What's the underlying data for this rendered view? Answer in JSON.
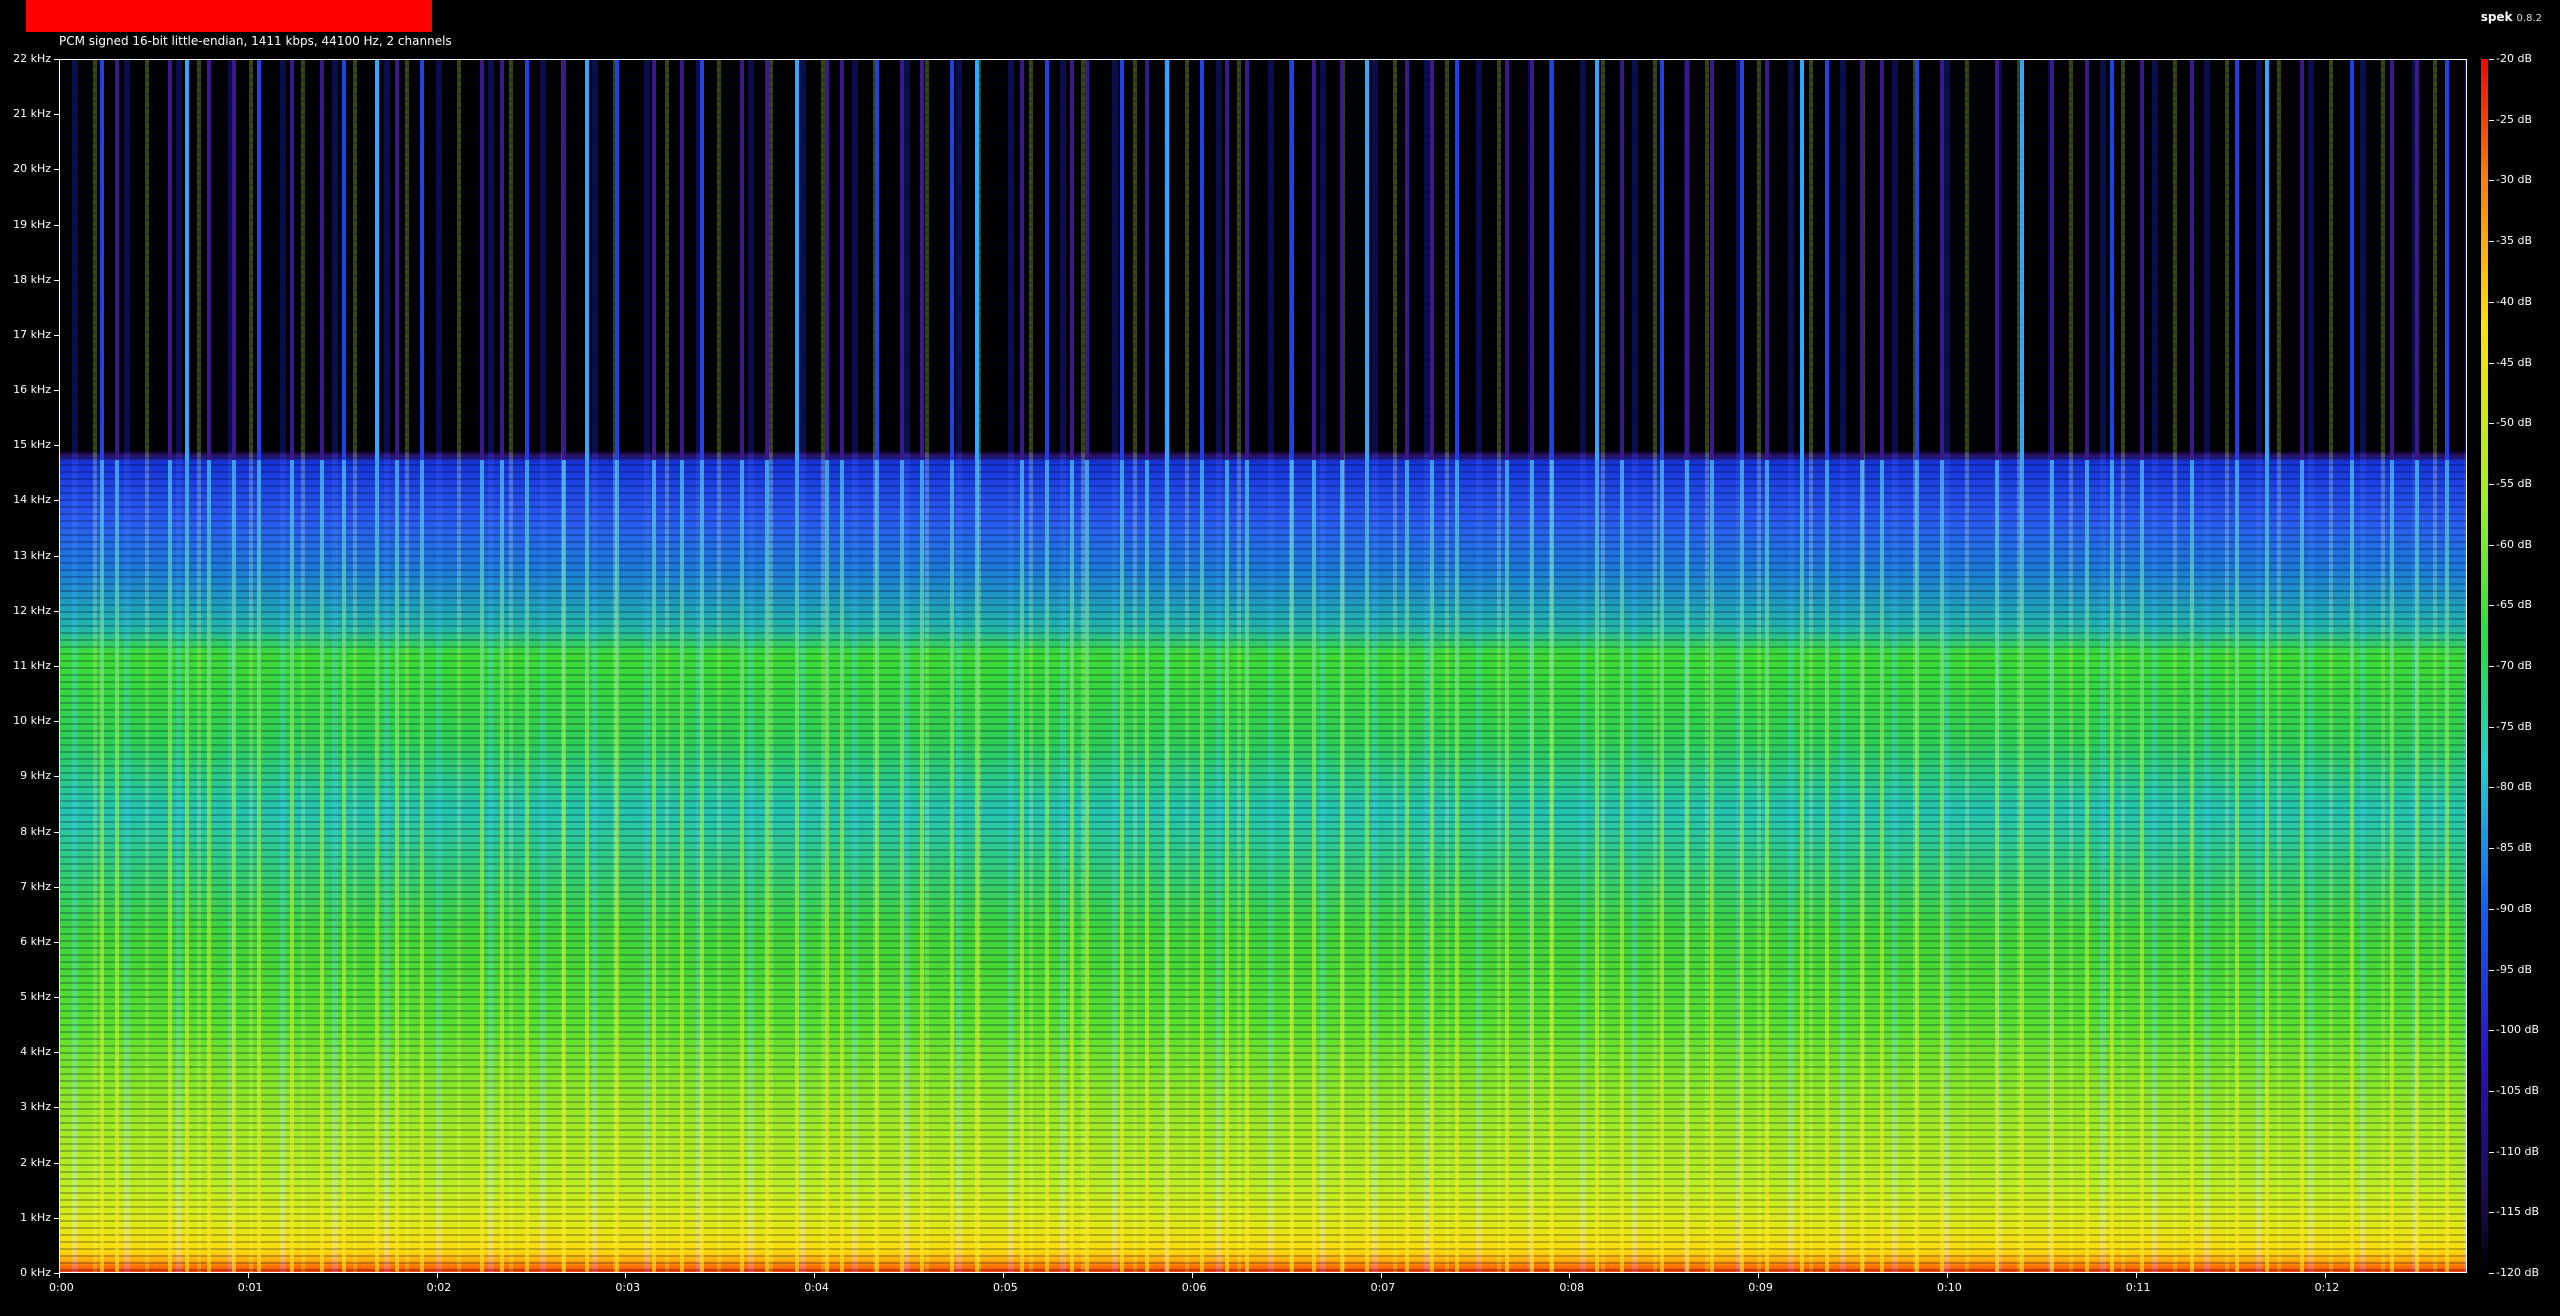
{
  "header": {
    "file_info": "PCM signed 16-bit little-endian, 1411 kbps, 44100 Hz, 2 channels",
    "app_name": "spek",
    "app_version": "0.8.2"
  },
  "axes": {
    "y_labels": [
      "22 kHz",
      "21 kHz",
      "20 kHz",
      "19 kHz",
      "18 kHz",
      "17 kHz",
      "16 kHz",
      "15 kHz",
      "14 kHz",
      "13 kHz",
      "12 kHz",
      "11 kHz",
      "10 kHz",
      "9 kHz",
      "8 kHz",
      "7 kHz",
      "6 kHz",
      "5 kHz",
      "4 kHz",
      "3 kHz",
      "2 kHz",
      "1 kHz",
      "0 kHz"
    ],
    "x_labels": [
      "0:00",
      "0:01",
      "0:02",
      "0:03",
      "0:04",
      "0:05",
      "0:06",
      "0:07",
      "0:08",
      "0:09",
      "0:10",
      "0:11",
      "0:12"
    ],
    "db_labels": [
      "-20 dB",
      "-25 dB",
      "-30 dB",
      "-35 dB",
      "-40 dB",
      "-45 dB",
      "-50 dB",
      "-55 dB",
      "-60 dB",
      "-65 dB",
      "-70 dB",
      "-75 dB",
      "-80 dB",
      "-85 dB",
      "-90 dB",
      "-95 dB",
      "-100 dB",
      "-105 dB",
      "-110 dB",
      "-115 dB",
      "-120 dB"
    ]
  },
  "colors": {
    "title_bar": "#ff0000",
    "background": "#000000"
  }
}
